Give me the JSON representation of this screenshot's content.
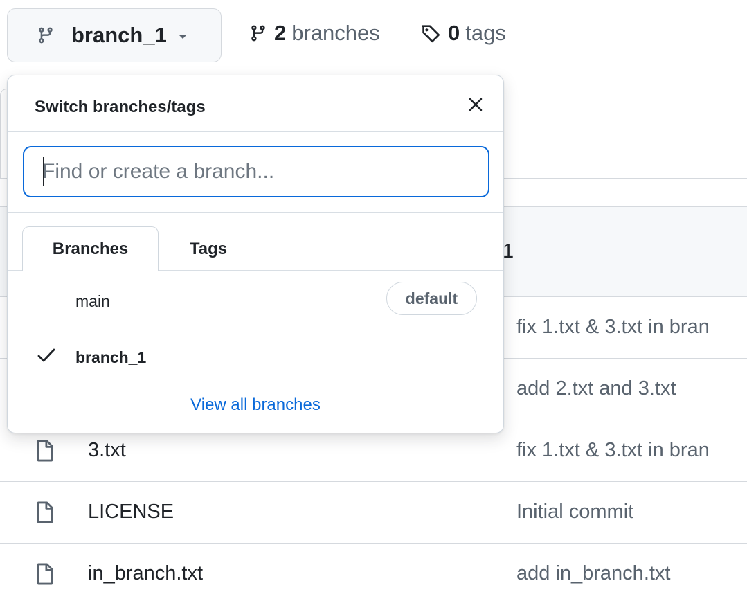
{
  "toolbar": {
    "current_branch": "branch_1",
    "branches_count": "2",
    "branches_label": "branches",
    "tags_count": "0",
    "tags_label": "tags"
  },
  "dropdown": {
    "title": "Switch branches/tags",
    "search_placeholder": "Find or create a branch...",
    "tabs": [
      {
        "label": "Branches",
        "active": true
      },
      {
        "label": "Tags",
        "active": false
      }
    ],
    "items": [
      {
        "name": "main",
        "badge": "default",
        "selected": false
      },
      {
        "name": "branch_1",
        "selected": true
      }
    ],
    "view_all_label": "View all branches"
  },
  "files": {
    "latest_commit_trailing": "1",
    "rows": [
      {
        "name": "",
        "message": "fix 1.txt & 3.txt in bran"
      },
      {
        "name": "",
        "message": "add 2.txt and 3.txt"
      },
      {
        "name": "3.txt",
        "message": "fix 1.txt & 3.txt in bran"
      },
      {
        "name": "LICENSE",
        "message": "Initial commit"
      },
      {
        "name": "in_branch.txt",
        "message": "add in_branch.txt"
      }
    ]
  },
  "icons": {
    "branch": "git-branch-icon",
    "tag": "tag-icon",
    "close": "close-icon",
    "check": "check-icon",
    "file": "file-icon",
    "caret": "caret-down-icon"
  },
  "colors": {
    "accent": "#0969da",
    "border": "#d0d7de",
    "muted": "#59636e",
    "button_bg": "#f6f8fa"
  }
}
